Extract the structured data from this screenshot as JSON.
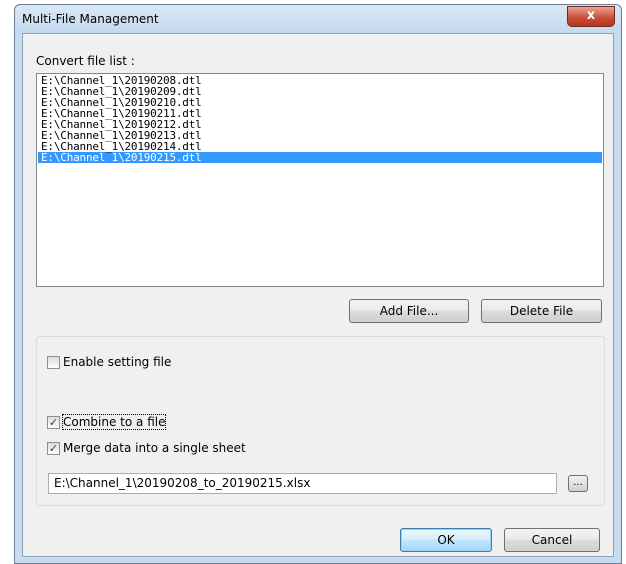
{
  "window": {
    "title": "Multi-File Management",
    "close_glyph": "x"
  },
  "list": {
    "label": "Convert file list :",
    "items": [
      "E:\\Channel_1\\20190208.dtl",
      "E:\\Channel_1\\20190209.dtl",
      "E:\\Channel_1\\20190210.dtl",
      "E:\\Channel_1\\20190211.dtl",
      "E:\\Channel_1\\20190212.dtl",
      "E:\\Channel_1\\20190213.dtl",
      "E:\\Channel_1\\20190214.dtl",
      "E:\\Channel_1\\20190215.dtl"
    ],
    "selected_index": 7
  },
  "buttons": {
    "add_file": "Add File...",
    "delete_file": "Delete File",
    "ok": "OK",
    "cancel": "Cancel",
    "browse": "..."
  },
  "options": {
    "enable_setting_file": {
      "label": "Enable setting file",
      "checked": false
    },
    "combine_to_file": {
      "label": "Combine to a file",
      "checked": true
    },
    "merge_single_sheet": {
      "label": "Merge data into a single sheet",
      "checked": true
    }
  },
  "output_path": "E:\\Channel_1\\20190208_to_20190215.xlsx",
  "check_glyph": "✓"
}
